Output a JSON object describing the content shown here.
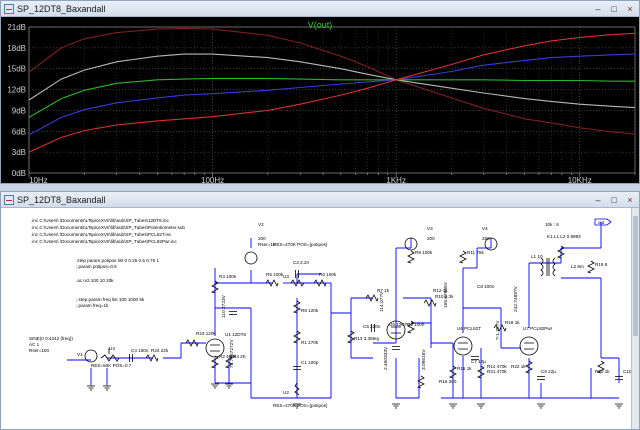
{
  "plot_window": {
    "title": "SP_12DT8_Baxandall",
    "buttons": {
      "minimize": "–",
      "maximize": "□",
      "close": "×"
    }
  },
  "schematic_window": {
    "title": "SP_12DT8_Baxandall",
    "buttons": {
      "minimize": "–",
      "maximize": "□",
      "close": "×"
    }
  },
  "chart_data": {
    "type": "line",
    "title": "V(out)",
    "x_scale": "log",
    "xlim": [
      10,
      20000
    ],
    "x_ticks": [
      {
        "value": 10,
        "label": "10Hz"
      },
      {
        "value": 100,
        "label": "100Hz"
      },
      {
        "value": 1000,
        "label": "1KHz"
      },
      {
        "value": 10000,
        "label": "10KHz"
      }
    ],
    "ylim": [
      0,
      21
    ],
    "y_ticks": [
      "0dB",
      "3dB",
      "6dB",
      "9dB",
      "12dB",
      "15dB",
      "18dB",
      "21dB"
    ],
    "y_tick_values": [
      0,
      3,
      6,
      9,
      12,
      15,
      18,
      21
    ],
    "grid": true,
    "background": "#000000",
    "title_color": "#32cd32",
    "x": [
      10,
      15,
      20,
      30,
      50,
      70,
      100,
      200,
      300,
      500,
      700,
      1000,
      2000,
      3000,
      5000,
      7000,
      10000,
      15000,
      20000
    ],
    "series": [
      {
        "color": "#7f1f1f",
        "values": [
          14.5,
          18.0,
          19.3,
          20.2,
          20.7,
          20.8,
          20.7,
          19.8,
          18.7,
          16.8,
          15.3,
          13.4,
          10.8,
          9.3,
          7.8,
          7.2,
          6.5,
          5.9,
          5.6
        ]
      },
      {
        "color": "#b8b8b8",
        "values": [
          10.5,
          13.5,
          14.8,
          16.0,
          16.8,
          17.1,
          17.1,
          16.6,
          16.0,
          15.0,
          14.2,
          13.4,
          12.2,
          11.5,
          10.7,
          10.3,
          9.9,
          9.6,
          9.4
        ]
      },
      {
        "color": "#2ab52a",
        "values": [
          8.0,
          10.7,
          11.9,
          12.9,
          13.4,
          13.5,
          13.6,
          13.6,
          13.5,
          13.4,
          13.4,
          13.4,
          13.4,
          13.4,
          13.3,
          13.3,
          13.3,
          13.2,
          13.2
        ]
      },
      {
        "color": "#3a3ad6",
        "values": [
          5.5,
          8.0,
          9.1,
          10.1,
          10.8,
          11.2,
          11.4,
          11.9,
          12.3,
          12.8,
          13.1,
          13.4,
          14.6,
          15.5,
          16.2,
          16.6,
          16.8,
          17.0,
          17.1
        ]
      },
      {
        "color": "#d63030",
        "values": [
          3.0,
          5.1,
          6.1,
          6.9,
          7.5,
          7.8,
          8.1,
          9.0,
          9.9,
          11.2,
          12.2,
          13.4,
          15.6,
          17.0,
          18.3,
          19.0,
          19.5,
          19.9,
          20.1
        ]
      }
    ]
  },
  "schematic": {
    "directives": [
      ".inc C:\\Users\\          \\Documents\\LTspiceXVII\\lib\\sub\\SP_Tubes\\12DT8.inc",
      ".inc C:\\Users\\          \\Documents\\LTspiceXVII\\lib\\sub\\SP_Tubes\\Potentiometer.sub",
      ".inc C:\\Users\\          \\Documents\\LTspiceXVII\\lib\\sub\\SP_Tubes\\PCL82T.inc",
      ".inc C:\\Users\\          \\Documents\\LTspiceXVII\\lib\\sub\\SP_Tubes\\PCL82Pwr.inc"
    ],
    "step_potipos": ".step param potipos list 0 0.25 0.5 0.75 1",
    "param_potipos": ";.param potipos=0.5",
    "ac_cmd": ".ac oct 100 10 20k",
    "step_freq": ";.step param freq list 100 1000 5k",
    "param_freq": ";.param freq=1k",
    "source": {
      "line1": "SINE(0 0.4242 {freq})",
      "line2": "AC 1",
      "line3": "Rser=100"
    },
    "pot_label_top": "RES=470K POS={potipos}",
    "pot_label_bottom": "RES=470K POS={potipos}",
    "input_pot_label": "RES=50K POS=0.7",
    "v2_label": "V2",
    "v2_value": "200",
    "v2_rser": "Rser=10",
    "v3_label": "V3",
    "v3_value": "200",
    "v4_label": "V4",
    "v4_value": "250",
    "k_label": "10k : 6",
    "k_line": "K1 L1 L2 0.9993",
    "out_label": "out",
    "parts": [
      {
        "n": "R3",
        "v": "100k"
      },
      {
        "n": "R5",
        "v": "100k"
      },
      {
        "n": "C2",
        "v": "2.2n"
      },
      {
        "n": "R6",
        "v": "100k"
      },
      {
        "n": "R8",
        "v": "120k"
      },
      {
        "n": "R1",
        "v": "270k"
      },
      {
        "n": "C1",
        "v": "100p"
      },
      {
        "n": "C5",
        "v": "220n"
      },
      {
        "n": "C4",
        "v": "150n"
      },
      {
        "n": "R24",
        "v": "22k"
      },
      {
        "n": "R23",
        "v": "120k"
      },
      {
        "n": "R2",
        "v": "470k"
      },
      {
        "n": "R4",
        "v": "2K"
      },
      {
        "n": "R13",
        "v": "3.3Meg"
      },
      {
        "n": "R7",
        "v": "1k"
      },
      {
        "n": "R9",
        "v": "100k"
      },
      {
        "n": "C6",
        "v": "100n"
      },
      {
        "n": "R10",
        "v": "2.3k"
      },
      {
        "n": "R12",
        "v": "1k"
      },
      {
        "n": "R11",
        "v": "75k"
      },
      {
        "n": "C8",
        "v": "100n"
      },
      {
        "n": "R14",
        "v": "470k"
      },
      {
        "n": "R15",
        "v": "1k"
      },
      {
        "n": "C7",
        "v": "10µ"
      },
      {
        "n": "R16",
        "v": "200"
      },
      {
        "n": "R18",
        "v": "1k"
      },
      {
        "n": "R21",
        "v": "470k"
      },
      {
        "n": "R22",
        "v": "1k"
      },
      {
        "n": "C9",
        "v": "22µ"
      },
      {
        "n": "L1",
        "v": "10"
      },
      {
        "n": "L2",
        "v": "8m"
      },
      {
        "n": "R19",
        "v": "8"
      },
      {
        "n": "R20",
        "v": "1k"
      },
      {
        "n": "C10",
        "v": "300p"
      },
      {
        "n": "V1",
        "v": ""
      },
      {
        "n": "U4",
        "v": ""
      },
      {
        "n": "U1",
        "v": "12DT8"
      },
      {
        "n": "U2",
        "v": ""
      },
      {
        "n": "U3",
        "v": ""
      },
      {
        "n": "U5",
        "v": "12DT8"
      },
      {
        "n": "U6",
        "v": "PCL82T"
      },
      {
        "n": "U7",
        "v": "PCL82Pwr"
      }
    ],
    "node_voltages": [
      "110.2723V",
      "71.7967272V",
      "114.07?V",
      "2.460333V",
      "3.09616V",
      "165.07695V",
      "242.7489?V",
      "?-1.78?V"
    ]
  }
}
